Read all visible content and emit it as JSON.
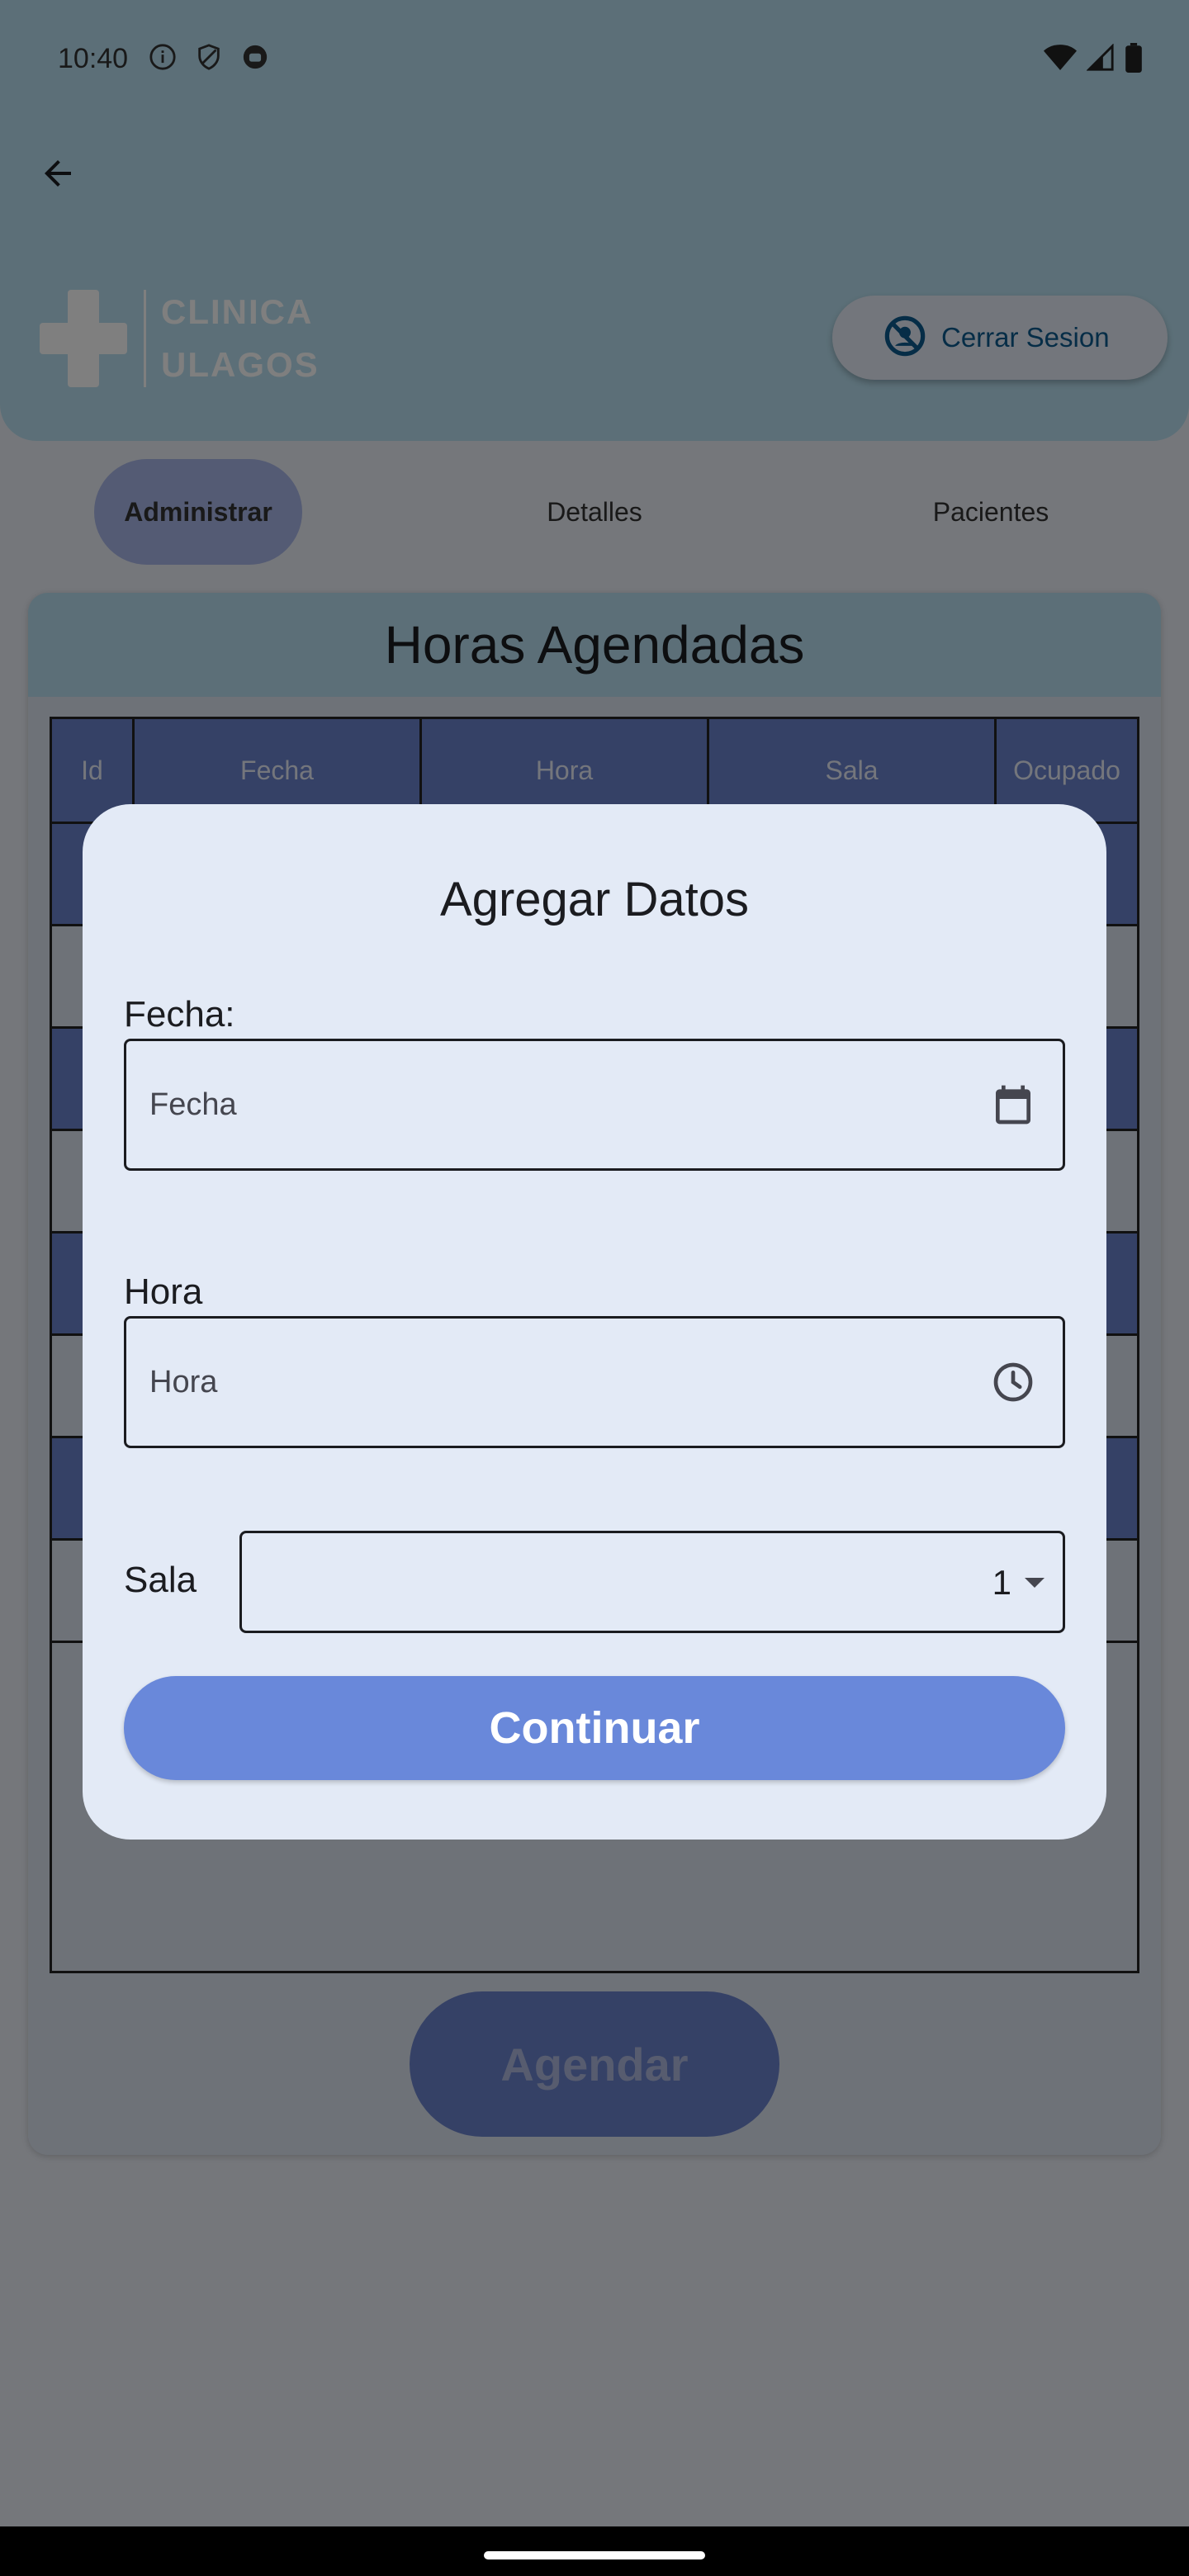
{
  "status_bar": {
    "time": "10:40"
  },
  "header": {
    "logo_line1": "CLINICA",
    "logo_line2": "ULAGOS",
    "logout_label": "Cerrar Sesion"
  },
  "tabs": [
    {
      "label": "Administrar",
      "active": true
    },
    {
      "label": "Detalles",
      "active": false
    },
    {
      "label": "Pacientes",
      "active": false
    }
  ],
  "schedule": {
    "title": "Horas Agendadas",
    "columns": [
      "Id",
      "Fecha",
      "Hora",
      "Sala",
      "Ocupado"
    ],
    "schedule_button": "Agendar"
  },
  "dialog": {
    "title": "Agregar Datos",
    "date_label": "Fecha:",
    "date_placeholder": "Fecha",
    "time_label": "Hora",
    "time_placeholder": "Hora",
    "room_label": "Sala",
    "room_value": "1",
    "continue_label": "Continuar"
  },
  "colors": {
    "header_bg": "#b8dff0",
    "accent": "#6988da",
    "table_header": "#6a82cc",
    "dialog_bg": "#e3eaf6"
  }
}
